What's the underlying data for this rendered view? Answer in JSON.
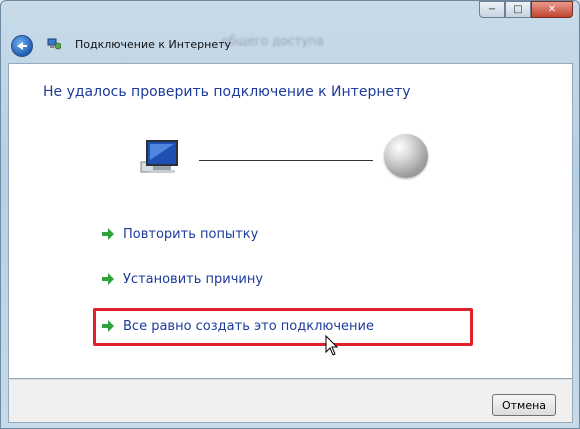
{
  "window": {
    "title": "Подключение к Интернету",
    "background_text": "... общего доступа"
  },
  "controls": {
    "minimize": "−",
    "maximize": "□",
    "close": "✕"
  },
  "main": {
    "heading": "Не удалось проверить подключение к Интернету",
    "options": [
      {
        "label": "Повторить попытку"
      },
      {
        "label": "Установить причину"
      },
      {
        "label": "Все равно создать это подключение",
        "highlighted": true
      }
    ]
  },
  "footer": {
    "cancel_label": "Отмена"
  },
  "icons": {
    "back": "back-arrow-icon",
    "title": "network-wizard-icon",
    "computer": "computer-icon",
    "internet": "globe-icon",
    "option_arrow": "green-arrow-icon",
    "cursor": "mouse-cursor-icon"
  },
  "colors": {
    "link_blue": "#1d3b9c",
    "highlight_red": "#e0202a",
    "arrow_green": "#2ea43a"
  }
}
